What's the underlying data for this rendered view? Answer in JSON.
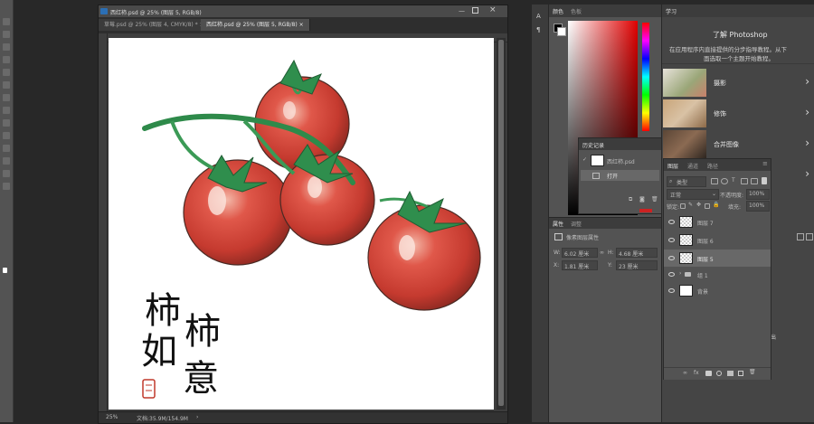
{
  "document": {
    "title": "西红柿.psd @ 25% (图层 5, RGB/8)",
    "tabs": [
      {
        "label": "草莓.psd @ 25% (图层 4, CMYK/8) *"
      },
      {
        "label": "西红柿.psd @ 25% (图层 5, RGB/8)"
      }
    ],
    "zoom": "25%",
    "doc_size": "文档:35.9M/154.9M",
    "calligraphy": [
      "柿",
      "柿",
      "如",
      "意"
    ]
  },
  "color_panel": {
    "tabs": [
      "颜色",
      "色板"
    ],
    "accent_red": "#cc2222"
  },
  "history_panel": {
    "tab": "历史记录",
    "items": [
      {
        "label": "西红柿.psd"
      },
      {
        "label": "打开"
      }
    ]
  },
  "properties_panel": {
    "tabs": [
      "属性",
      "调整"
    ],
    "header": "像素图层属性",
    "w_label": "W:",
    "w_value": "6.02 厘米",
    "h_label": "H:",
    "h_value": "4.68 厘米",
    "x_label": "X:",
    "x_value": "1.81 厘米",
    "y_label": "Y:",
    "y_value": "23 厘米"
  },
  "learn_panel": {
    "tab": "学习",
    "heading": "了解 Photoshop",
    "desc_line1": "在应用程序内直接提供的分步指导教程。从下",
    "desc_line2": "面选取一个主题开始教程。",
    "cards": [
      {
        "label": "摄影"
      },
      {
        "label": "修饰"
      },
      {
        "label": "合并图像"
      }
    ]
  },
  "layers_panel": {
    "tabs": [
      "图层",
      "通道",
      "路径"
    ],
    "filter_label": "类型",
    "blend_mode": "正常",
    "opacity_label": "不透明度:",
    "opacity_value": "100%",
    "lock_label": "锁定:",
    "fill_label": "填充:",
    "fill_value": "100%",
    "layers": [
      {
        "name": "图层 7"
      },
      {
        "name": "图层 6"
      },
      {
        "name": "图层 5"
      },
      {
        "name": "组 1"
      },
      {
        "name": "背景"
      }
    ]
  },
  "misc": {
    "edge_text": "出"
  }
}
